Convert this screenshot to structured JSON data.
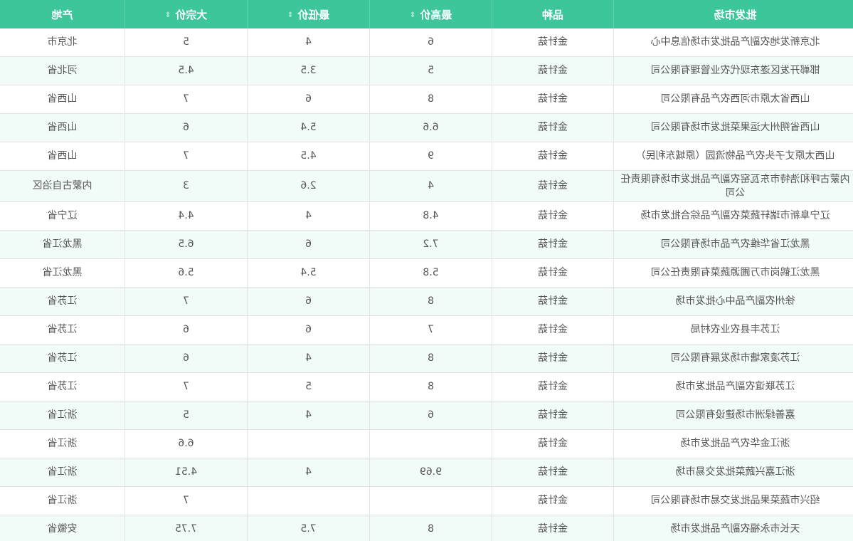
{
  "header": {
    "market": "批发市场",
    "variety": "品种",
    "high": "最高价",
    "low": "最低价",
    "bulk": "大宗价",
    "origin": "产地",
    "sort_glyph": "⇕"
  },
  "rows": [
    {
      "market": "北京新发地农副产品批发市场信息中心",
      "variety": "金针菇",
      "high": "6",
      "low": "4",
      "bulk": "5",
      "origin": "北京市"
    },
    {
      "market": "邯郸开发区遂东现代农业管理有限公司",
      "variety": "金针菇",
      "high": "5",
      "low": "3.5",
      "bulk": "4.5",
      "origin": "河北省"
    },
    {
      "market": "山西省太原市河西农产品有限公司",
      "variety": "金针菇",
      "high": "8",
      "low": "6",
      "bulk": "7",
      "origin": "山西省"
    },
    {
      "market": "山西省朔州大运果菜批发市场有限公司",
      "variety": "金针菇",
      "high": "6.6",
      "low": "5.4",
      "bulk": "6",
      "origin": "山西省"
    },
    {
      "market": "山西太原丈子头农产品物流园（原城东利民）",
      "variety": "金针菇",
      "high": "9",
      "low": "4.5",
      "bulk": "7",
      "origin": "山西省"
    },
    {
      "market": "内蒙古呼和浩特市东瓦窑农副产品批发市场有限责任公司",
      "variety": "金针菇",
      "high": "4",
      "low": "2.6",
      "bulk": "3",
      "origin": "内蒙古自治区"
    },
    {
      "market": "辽宁阜新市瑞轩蔬菜农副产品综合批发市场",
      "variety": "金针菇",
      "high": "4.8",
      "low": "4",
      "bulk": "4.4",
      "origin": "辽宁省"
    },
    {
      "market": "黑龙江省华维农产品市场有限公司",
      "variety": "金针菇",
      "high": "7.2",
      "low": "6",
      "bulk": "6.5",
      "origin": "黑龙江省"
    },
    {
      "market": "黑龙江鹤岗市万圃源蔬菜有限责任公司",
      "variety": "金针菇",
      "high": "5.8",
      "low": "5.4",
      "bulk": "5.6",
      "origin": "黑龙江省"
    },
    {
      "market": "徐州农副产品中心批发市场",
      "variety": "金针菇",
      "high": "8",
      "low": "6",
      "bulk": "7",
      "origin": "江苏省"
    },
    {
      "market": "江苏丰县农业农村局",
      "variety": "金针菇",
      "high": "7",
      "low": "6",
      "bulk": "6",
      "origin": "江苏省"
    },
    {
      "market": "江苏凌家塘市场发展有限公司",
      "variety": "金针菇",
      "high": "8",
      "low": "4",
      "bulk": "6",
      "origin": "江苏省"
    },
    {
      "market": "江苏联谊农副产品批发市场",
      "variety": "金针菇",
      "high": "8",
      "low": "5",
      "bulk": "7",
      "origin": "江苏省"
    },
    {
      "market": "嘉善绿洲市场建设有限公司",
      "variety": "金针菇",
      "high": "6",
      "low": "4",
      "bulk": "5",
      "origin": "浙江省"
    },
    {
      "market": "浙江金华农产品批发市场",
      "variety": "金针菇",
      "high": "",
      "low": "",
      "bulk": "6.6",
      "origin": "浙江省"
    },
    {
      "market": "浙江嘉兴蔬菜批发交易市场",
      "variety": "金针菇",
      "high": "9.69",
      "low": "4",
      "bulk": "4.51",
      "origin": "浙江省"
    },
    {
      "market": "绍兴市蔬菜果品批发交易市场有限公司",
      "variety": "金针菇",
      "high": "",
      "low": "",
      "bulk": "7",
      "origin": "浙江省"
    },
    {
      "market": "天长市永福农副产品批发市场",
      "variety": "金针菇",
      "high": "8",
      "low": "7.5",
      "bulk": "7.75",
      "origin": "安徽省"
    }
  ]
}
